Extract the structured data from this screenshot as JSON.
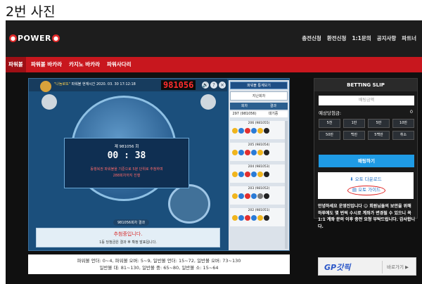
{
  "caption": "2번 사진",
  "logo": {
    "word": "POWER",
    "badge_left": "",
    "badge_right": ""
  },
  "topnav": [
    "충전신청",
    "환전신청",
    "1:1문의",
    "공지사항",
    "파트너"
  ],
  "tabs": [
    {
      "label": "파워볼",
      "active": true
    },
    {
      "label": "파워볼 바카라",
      "active": false
    },
    {
      "label": "카지노 바카라",
      "active": false
    },
    {
      "label": "파워사다리",
      "active": false
    }
  ],
  "game": {
    "info_brand": "\"나눔로또\"",
    "info_text": "파워볼 현재시간",
    "info_time": "2020. 03. 30  17:12:18",
    "round_big": "981056",
    "controls": [
      "🔊",
      "?",
      "×"
    ],
    "countdown_round": "제 981056 회",
    "timer": "00 : 38",
    "note_lines": [
      "동행복권 파워볼을 기준으로 5분 단위로 추첨하며",
      "288회차까지 진행"
    ],
    "result_label": "981056회차 결과",
    "banner_title": "추첨중입니다.",
    "banner_sub": "1등 당첨금은 결과 후 확정 발표됩니다."
  },
  "history": {
    "btn_stats": "파워볼 통계보기",
    "btn_prev": "지난회차",
    "headers": [
      "회차",
      "결과"
    ],
    "pending": {
      "round": "297 (981056)",
      "status": "대기중"
    },
    "rows": [
      {
        "round": "206 (981055)",
        "balls": [
          "y",
          "bl",
          "r",
          "bl",
          "y",
          "k"
        ]
      },
      {
        "round": "205 (981054)",
        "balls": [
          "y",
          "bl",
          "r",
          "bl",
          "y",
          "k"
        ]
      },
      {
        "round": "204 (981053)",
        "balls": [
          "y",
          "bl",
          "r",
          "bl",
          "y",
          "k"
        ]
      },
      {
        "round": "203 (981052)",
        "balls": [
          "y",
          "bl",
          "r",
          "bl",
          "g",
          "k"
        ]
      },
      {
        "round": "202 (981051)",
        "balls": [
          "y",
          "bl",
          "r",
          "bl",
          "y",
          "k"
        ]
      }
    ]
  },
  "footer_lines": [
    "파워볼 언더: 0~4, 파워볼 오버: 5~9, 일반볼 언더: 15~72, 일반볼 오버: 73~130",
    "일반볼 대: 81~130, 일반볼 중: 65~80, 일반볼 소: 15~64"
  ],
  "slip": {
    "title": "BETTING SLIP",
    "amount_placeholder": "배팅금액",
    "expected_label": "예상당첨금:",
    "expected_value": "0",
    "chips": [
      "5천",
      "1만",
      "5만",
      "10만",
      "50만",
      "백만",
      "5백만",
      "취소"
    ],
    "bet_button": "배팅하기"
  },
  "links": {
    "download": "오토 다운로드",
    "guide": "오토 가이드"
  },
  "notice": "안녕하세요 운영진입니다 ☺ 회원님들의 보안을 위해 하루에도 몇 번씩 수시로 계좌가 변경될 수 있으니 꼭 1:1 계좌 문의 이후 충전 요청 부탁드립니다. 감사합니다.",
  "gpk": {
    "logo": "GP갓픽",
    "go": "바로가기 ▶"
  },
  "colors": {
    "red": "#c8171e",
    "blue": "#1f9be5",
    "navy": "#1b4f7c"
  }
}
